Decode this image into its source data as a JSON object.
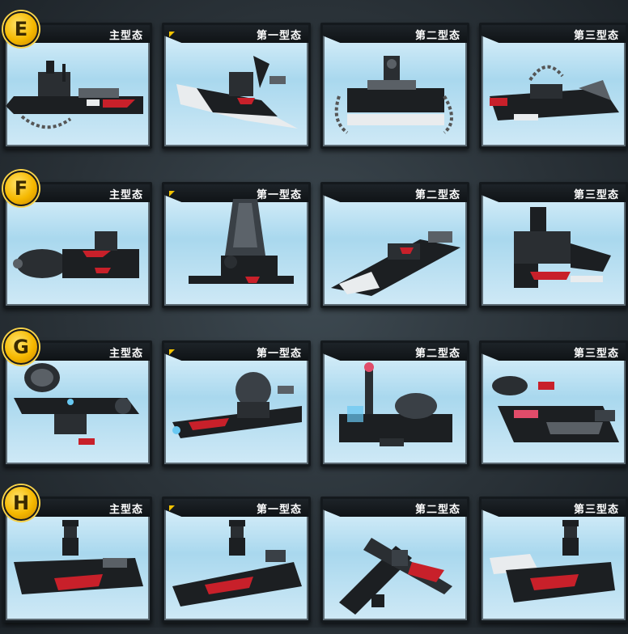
{
  "rows": [
    {
      "letter": "E",
      "forms": [
        "主型态",
        "第一型态",
        "第二型态",
        "第三型态"
      ],
      "models": [
        "warship-with-anchor-chain",
        "winged-jet-craft",
        "chain-hover-vessel",
        "chain-speedboat"
      ]
    },
    {
      "letter": "F",
      "forms": [
        "主型态",
        "第一型态",
        "第二型态",
        "第三型态"
      ],
      "models": [
        "submarine",
        "shuttle-with-tall-fin",
        "stealth-boat",
        "walker-turret"
      ]
    },
    {
      "letter": "G",
      "forms": [
        "主型态",
        "第一型态",
        "第二型态",
        "第三型态"
      ],
      "models": [
        "radar-dish-jet",
        "dome-cruiser",
        "missile-base",
        "red-thruster-boat"
      ]
    },
    {
      "letter": "H",
      "forms": [
        "主型态",
        "第一型态",
        "第二型态",
        "第三型态"
      ],
      "models": [
        "officer-hover-boat",
        "officer-speedboat",
        "x-wing-fighter",
        "officer-gunboat"
      ]
    }
  ],
  "colors": {
    "brick_dark": "#1c1f22",
    "brick_gray": "#5a6066",
    "brick_white": "#e9ecee",
    "accent_red": "#c8202a",
    "badge_gold": "#f5b800"
  }
}
